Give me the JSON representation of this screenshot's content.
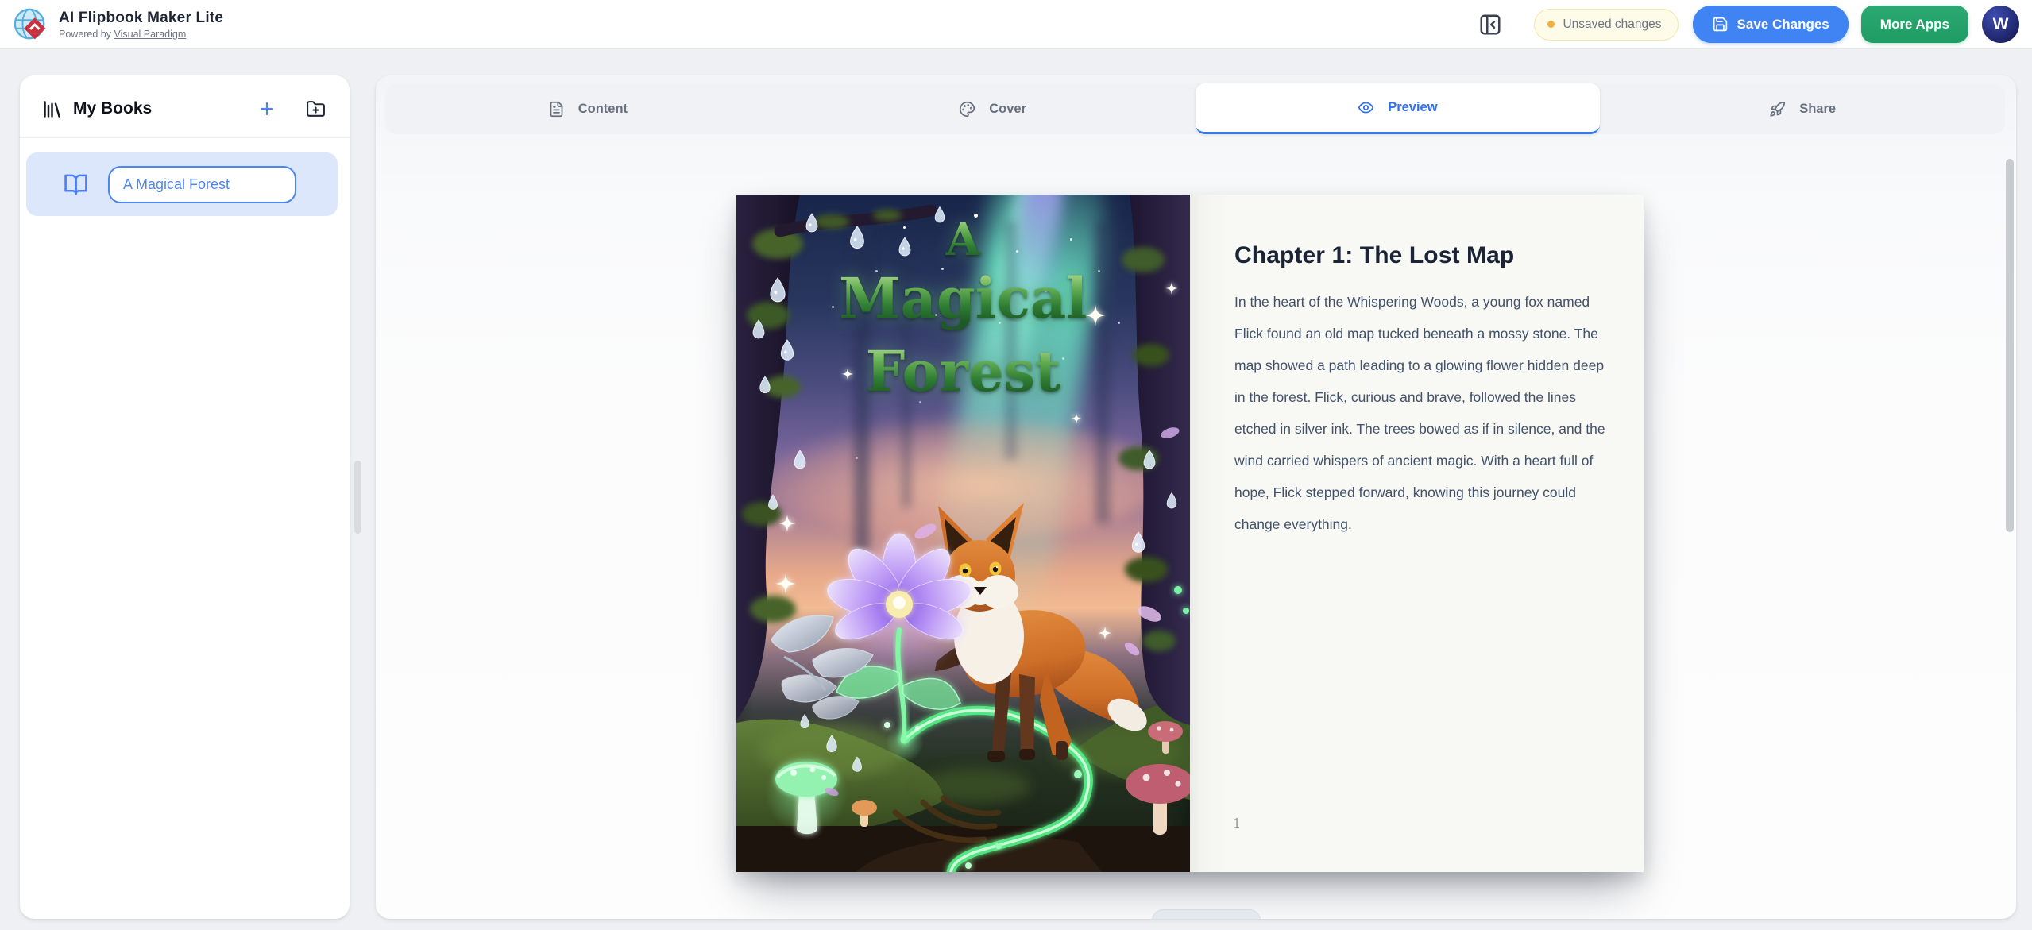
{
  "header": {
    "app_title": "AI Flipbook Maker Lite",
    "powered_by_prefix": "Powered by ",
    "powered_by_link": "Visual Paradigm",
    "unsaved_badge": "Unsaved changes",
    "save_button": "Save Changes",
    "more_apps_button": "More Apps",
    "avatar_initial": "W"
  },
  "sidebar": {
    "title": "My Books",
    "book_title_value": "A Magical Forest"
  },
  "tabs": [
    {
      "label": "Content",
      "icon": "document-icon",
      "active": false
    },
    {
      "label": "Cover",
      "icon": "palette-icon",
      "active": false
    },
    {
      "label": "Preview",
      "icon": "eye-icon",
      "active": true
    },
    {
      "label": "Share",
      "icon": "rocket-icon",
      "active": false
    }
  ],
  "book": {
    "cover_title_line1": "A",
    "cover_title_line2": "Magical",
    "cover_title_line3": "Forest",
    "page": {
      "heading": "Chapter 1: The Lost Map",
      "body": "In the heart of the Whispering Woods, a young fox named Flick found an old map tucked beneath a mossy stone. The map showed a path leading to a glowing flower hidden deep in the forest. Flick, curious and brave, followed the lines etched in silver ink. The trees bowed as if in silence, and the wind carried whispers of ancient magic. With a heart full of hope, Flick stepped forward, knowing this journey could change everything.",
      "page_number": "1"
    }
  },
  "colors": {
    "accent_blue": "#3578f0",
    "save_button_blue": "#4083f2",
    "more_apps_green": "#23a169",
    "badge_bg": "#fefbe9",
    "badge_border": "#f3e7ab",
    "badge_dot": "#f2b13e",
    "selected_item_bg": "#dce7fc",
    "page_bg": "#eef0f3",
    "paper": "#f8f8f5"
  }
}
